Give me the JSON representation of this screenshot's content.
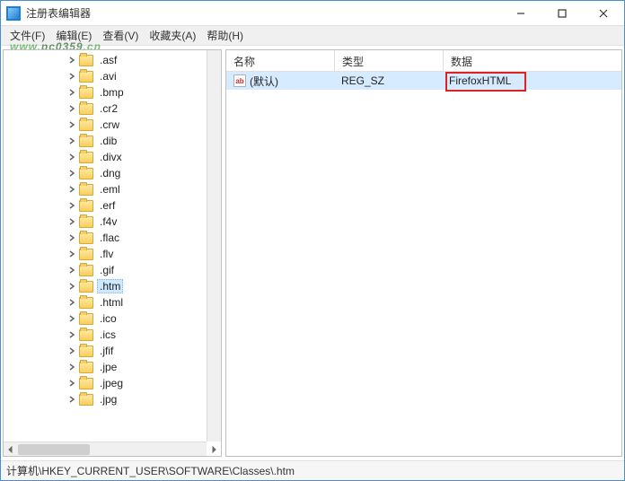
{
  "window": {
    "title": "注册表编辑器"
  },
  "menu": {
    "file": "文件(F)",
    "edit": "编辑(E)",
    "view": "查看(V)",
    "favorites": "收藏夹(A)",
    "help": "帮助(H)"
  },
  "watermark": {
    "text_a": "www.",
    "text_b": "pc0359",
    "text_c": ".cn"
  },
  "tree": {
    "items": [
      {
        "label": ".asf",
        "depth": 5,
        "exp": "right"
      },
      {
        "label": ".avi",
        "depth": 5,
        "exp": "right"
      },
      {
        "label": ".bmp",
        "depth": 5,
        "exp": "right"
      },
      {
        "label": ".cr2",
        "depth": 5,
        "exp": "right"
      },
      {
        "label": ".crw",
        "depth": 5,
        "exp": "right"
      },
      {
        "label": ".dib",
        "depth": 5,
        "exp": "right"
      },
      {
        "label": ".divx",
        "depth": 5,
        "exp": "right"
      },
      {
        "label": ".dng",
        "depth": 5,
        "exp": "right"
      },
      {
        "label": ".eml",
        "depth": 5,
        "exp": "right"
      },
      {
        "label": ".erf",
        "depth": 5,
        "exp": "right"
      },
      {
        "label": ".f4v",
        "depth": 5,
        "exp": "right"
      },
      {
        "label": ".flac",
        "depth": 5,
        "exp": "right"
      },
      {
        "label": ".flv",
        "depth": 5,
        "exp": "right"
      },
      {
        "label": ".gif",
        "depth": 5,
        "exp": "right"
      },
      {
        "label": ".htm",
        "depth": 5,
        "exp": "right",
        "selected": true
      },
      {
        "label": ".html",
        "depth": 5,
        "exp": "right"
      },
      {
        "label": ".ico",
        "depth": 5,
        "exp": "right"
      },
      {
        "label": ".ics",
        "depth": 5,
        "exp": "right"
      },
      {
        "label": ".jfif",
        "depth": 5,
        "exp": "right"
      },
      {
        "label": ".jpe",
        "depth": 5,
        "exp": "right"
      },
      {
        "label": ".jpeg",
        "depth": 5,
        "exp": "right"
      },
      {
        "label": ".jpg",
        "depth": 5,
        "exp": "right"
      }
    ]
  },
  "list": {
    "columns": {
      "name": "名称",
      "type": "类型",
      "data": "数据"
    },
    "col_widths": {
      "name": 120,
      "type": 120,
      "data": 180
    },
    "rows": [
      {
        "name": "(默认)",
        "type": "REG_SZ",
        "data": "FirefoxHTML"
      }
    ]
  },
  "status": {
    "path": "计算机\\HKEY_CURRENT_USER\\SOFTWARE\\Classes\\.htm"
  },
  "icons": {
    "ab_text": "ab"
  }
}
